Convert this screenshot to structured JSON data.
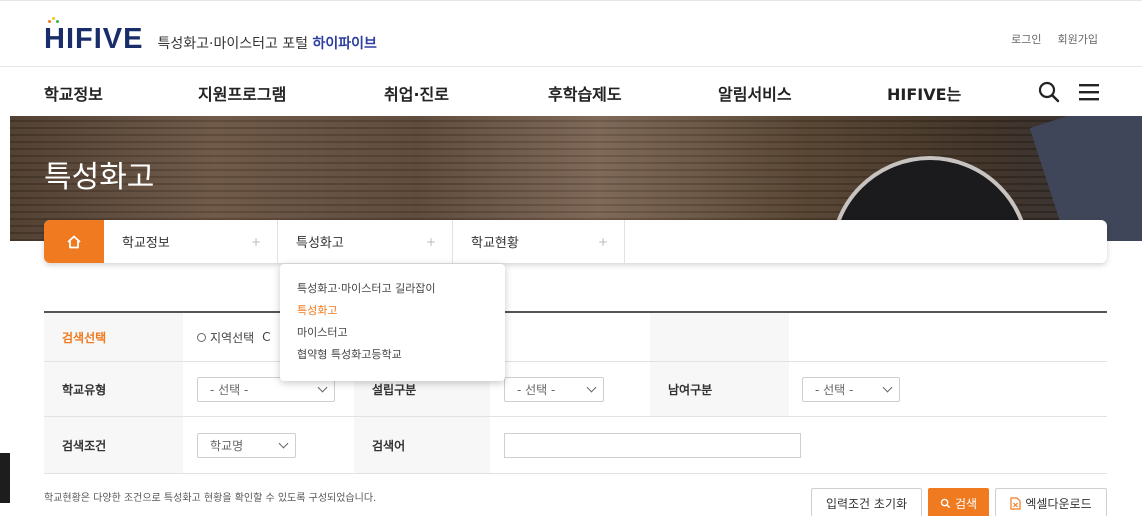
{
  "header": {
    "logo_text": "HIFIVE",
    "logo_sub": "특성화고·마이스터고 포털",
    "logo_sub_strong": "하이파이브",
    "login": "로그인",
    "join": "회원가입"
  },
  "gnb": {
    "items": [
      "학교정보",
      "지원프로그램",
      "취업·진로",
      "후학습제도",
      "알림서비스",
      "HIFIVE는"
    ],
    "icons": [
      "search-icon",
      "menu-icon"
    ]
  },
  "hero": {
    "title": "특성화고"
  },
  "breadcrumb": {
    "items": [
      "학교정보",
      "특성화고",
      "학교현황"
    ],
    "plus": "+"
  },
  "dropdown": {
    "items": [
      "특성화고·마이스터고 길라잡이",
      "특성화고",
      "마이스터고",
      "협약형 특성화고등학교"
    ],
    "active_index": 1
  },
  "search": {
    "row1": {
      "label": "검색선택",
      "radio_region": "지역선택",
      "radio_other": "C"
    },
    "row2": {
      "school_type_label": "학교유형",
      "school_type_value": "- 선택 -",
      "found_label": "설립구분",
      "found_value": "- 선택 -",
      "gender_label": "남여구분",
      "gender_value": "- 선택 -"
    },
    "row3": {
      "cond_label": "검색조건",
      "cond_value": "학교명",
      "keyword_label": "검색어",
      "keyword_value": ""
    }
  },
  "footer": {
    "note": "학교현황은 다양한 조건으로 특성화고 현황을 확인할 수 있도록 구성되었습니다.",
    "reset_button": "입력조건 초기화",
    "search_button": "검색",
    "excel_button": "엑셀다운로드"
  },
  "colors": {
    "accent": "#f07a1f",
    "brand": "#1a2d6b"
  }
}
